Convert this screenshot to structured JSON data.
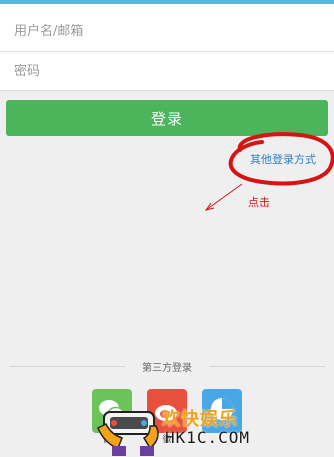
{
  "login_form": {
    "username_placeholder": "用户名/邮箱",
    "password_placeholder": "密码"
  },
  "login_button": {
    "label": "登录"
  },
  "other_login": {
    "label": "其他登录方式"
  },
  "annotation": {
    "click_label": "点击"
  },
  "third_party": {
    "title": "第三方登录",
    "providers": [
      {
        "name": "微信",
        "icon": "wechat-icon",
        "color": "#6cc35a"
      },
      {
        "name": "微",
        "icon": "weibo-icon",
        "color": "#e84f3c"
      },
      {
        "name": "",
        "icon": "qq-icon",
        "color": "#49a7e6"
      }
    ]
  },
  "watermark": {
    "cn_text": "欢快娱乐",
    "en_text": "HK1C.COM"
  },
  "colors": {
    "accent_bar": "#59b4dc",
    "login_green": "#4cb45a",
    "link_blue": "#2f7fc3",
    "annotation_red": "#c61a1a"
  }
}
